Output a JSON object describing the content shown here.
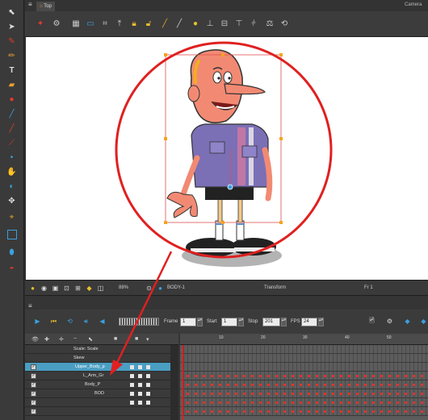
{
  "app": {
    "tab_label": "Top",
    "camera_label": "Camera"
  },
  "left_toolbar": {
    "tools": [
      "select-icon",
      "contour-editor-icon",
      "brush-icon",
      "pencil-icon",
      "text-icon",
      "eraser-icon",
      "paint-icon",
      "line-icon",
      "stroke-icon",
      "dropper-icon",
      "morph-icon",
      "hand-icon",
      "rotate-icon",
      "transform-icon",
      "rectangle-icon",
      "drawing-pivot-icon",
      "ink-icon"
    ]
  },
  "status_bar": {
    "zoom": "88%",
    "node": "BODY-1",
    "mode": "Transform",
    "frame_label": "Fr 1"
  },
  "timeline": {
    "frame_label": "Frame",
    "frame_value": "1",
    "start_label": "Start",
    "start_value": "1",
    "stop_label": "Stop",
    "stop_value": "201",
    "fps_label": "FPS",
    "fps_value": "24",
    "ruler_ticks": [
      "10",
      "20",
      "30",
      "40",
      "50"
    ],
    "layers": [
      {
        "name": "Scale: Scale"
      },
      {
        "name": "Skew"
      },
      {
        "name": "Upper_Body_p",
        "selected": true
      },
      {
        "name": "L_Arm_Gr"
      },
      {
        "name": "Body_P"
      },
      {
        "name": "BOD"
      },
      {
        "name": ""
      }
    ]
  },
  "colors": {
    "selection": "#4a9ec2",
    "callout": "#e02020",
    "keyframe": "#e5322d"
  }
}
